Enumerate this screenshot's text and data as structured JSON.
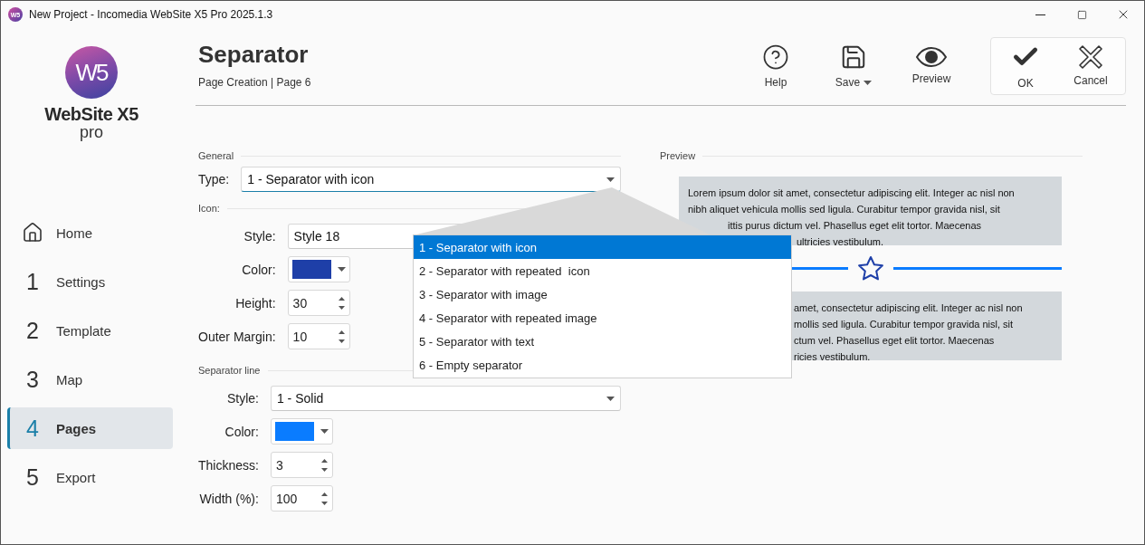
{
  "window": {
    "app_icon": "W5",
    "title": "New Project - Incomedia WebSite X5 Pro 2025.1.3"
  },
  "logo": {
    "mark": "W5",
    "name": "WebSite X5",
    "edition": "pro"
  },
  "sidebar": {
    "items": [
      {
        "kind": "home",
        "marker": "",
        "label": "Home",
        "selected": false
      },
      {
        "kind": "number",
        "marker": "1",
        "label": "Settings",
        "selected": false
      },
      {
        "kind": "number",
        "marker": "2",
        "label": "Template",
        "selected": false
      },
      {
        "kind": "number",
        "marker": "3",
        "label": "Map",
        "selected": false
      },
      {
        "kind": "number",
        "marker": "4",
        "label": "Pages",
        "selected": true
      },
      {
        "kind": "number",
        "marker": "5",
        "label": "Export",
        "selected": false
      }
    ]
  },
  "header": {
    "title": "Separator",
    "subtitle": "Page Creation | Page 6"
  },
  "toolbar": [
    {
      "kind": "help",
      "label": "Help"
    },
    {
      "kind": "save",
      "label": "Save",
      "menu": true
    },
    {
      "kind": "preview",
      "label": "Preview"
    }
  ],
  "dialog_buttons": [
    {
      "kind": "ok",
      "label": "OK"
    },
    {
      "kind": "cancel",
      "label": "Cancel"
    }
  ],
  "general": {
    "heading": "General",
    "type_label": "Type:",
    "type_value": "1 - Separator with icon"
  },
  "icon_section": {
    "heading": "Icon:",
    "fields": [
      {
        "kind": "select",
        "label": "Style:",
        "value": "Style 18"
      },
      {
        "kind": "color",
        "label": "Color:",
        "color": "#1e3fa8"
      },
      {
        "kind": "spin",
        "label": "Height:",
        "value": "30"
      },
      {
        "kind": "spin",
        "label": "Outer Margin:",
        "value": "10"
      }
    ]
  },
  "line_section": {
    "heading": "Separator line",
    "fields": [
      {
        "kind": "select",
        "label": "Style:",
        "value": "1 - Solid",
        "caret": true
      },
      {
        "kind": "color",
        "label": "Color:",
        "color": "#0a7cff"
      },
      {
        "kind": "spin",
        "label": "Thickness:",
        "value": "3"
      },
      {
        "kind": "spin",
        "label": "Width (%):",
        "value": "100"
      }
    ]
  },
  "preview": {
    "heading": "Preview",
    "paragraphs": [
      [
        "Lorem ipsum dolor sit amet, consectetur adipiscing elit. Integer ac nisl non",
        "nibh aliquet vehicula mollis sed ligula. Curabitur tempor gravida nisl, sit",
        "ittis purus dictum vel. Phasellus eget elit tortor. Maecenas",
        "ultricies vestibulum."
      ],
      [
        "amet, consectetur adipiscing elit. Integer ac nisl non",
        "mollis sed ligula. Curabitur tempor gravida nisl, sit",
        "ctum vel. Phasellus eget elit tortor. Maecenas",
        "ricies vestibulum."
      ]
    ]
  },
  "dropdown": {
    "options": [
      {
        "label": "1 - Separator with icon",
        "selected": true
      },
      {
        "label": "2 - Separator with repeated  icon",
        "selected": false
      },
      {
        "label": "3 - Separator with image",
        "selected": false
      },
      {
        "label": "4 - Separator with repeated image",
        "selected": false
      },
      {
        "label": "5 - Separator with text",
        "selected": false
      },
      {
        "label": "6 - Empty separator",
        "selected": false
      }
    ]
  }
}
